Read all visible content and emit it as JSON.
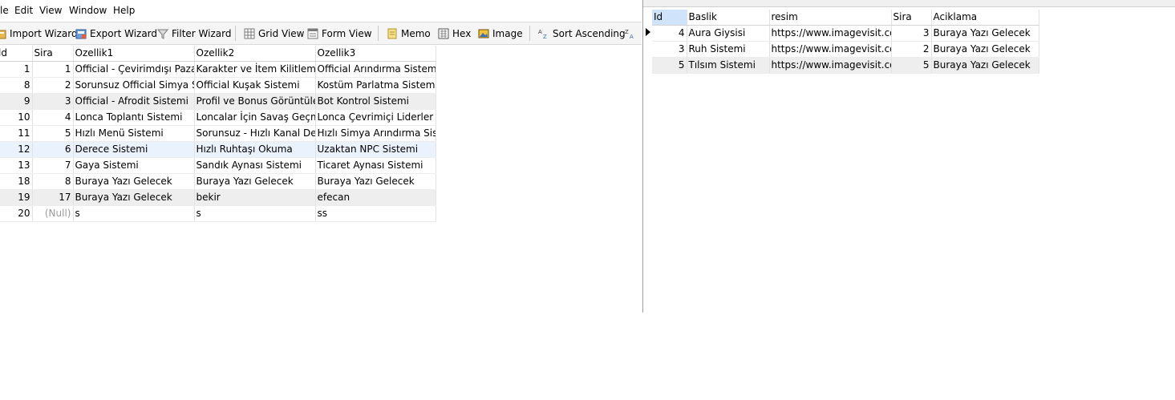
{
  "menu": [
    "le",
    "Edit",
    "View",
    "Window",
    "Help"
  ],
  "toolbar": {
    "import": "Import Wizard",
    "export": "Export Wizard",
    "filter": "Filter Wizard",
    "grid": "Grid View",
    "form": "Form View",
    "memo": "Memo",
    "hex": "Hex",
    "image": "Image",
    "sort": "Sort Ascending"
  },
  "left_table": {
    "headers": [
      "ld",
      "Sira",
      "Ozellik1",
      "Ozellik2",
      "Ozellik3"
    ],
    "rows": [
      [
        "1",
        "1",
        "Official - Çevirimdışı Pazar S",
        "Karakter ve İtem Kilitleme Si",
        "Official Arındırma Sistemi"
      ],
      [
        "8",
        "2",
        "Sorunsuz Official Simya Sist",
        "Official Kuşak Sistemi",
        "Kostüm Parlatma Sistemi"
      ],
      [
        "9",
        "3",
        "Official - Afrodit Sistemi",
        "Profil ve Bonus Görüntülem",
        "Bot Kontrol Sistemi"
      ],
      [
        "10",
        "4",
        "Lonca Toplantı Sistemi",
        "Loncalar İçin Savaş Geçmişi",
        "Lonca Çevrimiçi Liderler Sist"
      ],
      [
        "11",
        "5",
        "Hızlı Menü Sistemi",
        "Sorunsuz - Hızlı Kanal Değiş",
        "Hızlı Simya Arındırma Sister"
      ],
      [
        "12",
        "6",
        "Derece Sistemi",
        "Hızlı Ruhtaşı Okuma",
        "Uzaktan NPC Sistemi"
      ],
      [
        "13",
        "7",
        "Gaya Sistemi",
        "Sandık Aynası Sistemi",
        "Ticaret Aynası Sistemi"
      ],
      [
        "18",
        "8",
        "Buraya Yazı Gelecek",
        "Buraya Yazı Gelecek",
        "Buraya Yazı Gelecek"
      ],
      [
        "19",
        "17",
        "Buraya Yazı Gelecek",
        "bekir",
        "efecan"
      ],
      [
        "20",
        "(Null)",
        "s",
        "s",
        "ss"
      ]
    ]
  },
  "right_table": {
    "headers": [
      "Id",
      "Baslik",
      "resim",
      "Sira",
      "Aciklama"
    ],
    "rows": [
      [
        "4",
        "Aura Giysisi",
        "https://www.imagevisit.con",
        "3",
        "Buraya Yazı Gelecek"
      ],
      [
        "3",
        "Ruh Sistemi",
        "https://www.imagevisit.con",
        "2",
        "Buraya Yazı Gelecek"
      ],
      [
        "5",
        "Tılsım Sistemi",
        "https://www.imagevisit.con",
        "5",
        "Buraya Yazı Gelecek"
      ]
    ]
  }
}
